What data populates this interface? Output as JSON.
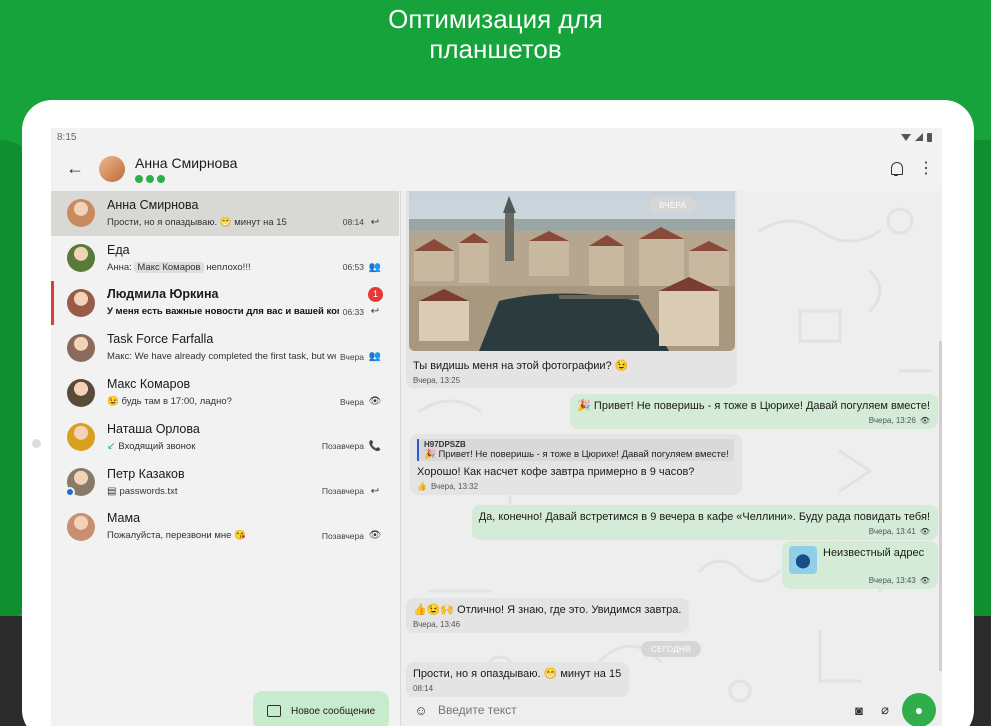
{
  "promo": {
    "line1": "Оптимизация для",
    "line2": "планшетов"
  },
  "statusbar": {
    "time": "8:15"
  },
  "toolbar": {
    "back_icon": "arrow-back-icon",
    "title": "Анна Смирнова",
    "bell_icon": "bell-icon",
    "more_icon": "more-vert-icon"
  },
  "chats": [
    {
      "name": "Анна Смирнова",
      "preview": "Прости, но я опаздываю. 😁 минут на 15",
      "time": "08:14",
      "status_icon": "reply-icon",
      "status_glyph": "↩",
      "selected": true,
      "avatar_color": "#c98a5e"
    },
    {
      "name": "Еда",
      "preview_prefix": "Анна:",
      "preview_chip": "Макс Комаров",
      "preview": "неплохо!!!",
      "time": "06:53",
      "status_icon": "group-icon",
      "status_glyph": "👥",
      "avatar_color": "#5a7a3a"
    },
    {
      "name": "Людмила Юркина",
      "preview": "У меня есть важные новости для вас и вашей ком",
      "time": "06:33",
      "status_icon": "reply-icon",
      "status_glyph": "↩",
      "unread": "1",
      "avatar_color": "#9a5a4a"
    },
    {
      "name": "Task Force Farfalla",
      "preview_prefix": "Макс:",
      "preview": "We have already completed the first task, but we",
      "time": "Вчера",
      "status_icon": "group-icon",
      "status_glyph": "👥",
      "avatar_color": "#8a6a5a"
    },
    {
      "name": "Макс Комаров",
      "preview": "😉 будь там в 17:00, ладно?",
      "time": "Вчера",
      "status_icon": "eye-icon",
      "status_glyph": "👁",
      "avatar_color": "#5a4a3a"
    },
    {
      "name": "Наташа Орлова",
      "preview_icon": "missed-call-icon",
      "preview_icon_glyph": "↙",
      "preview": "Входящий звонок",
      "time": "Позавчера",
      "status_icon": "phone-callback-icon",
      "status_glyph": "📞",
      "avatar_color": "#d9a020"
    },
    {
      "name": "Петр Казаков",
      "preview_icon": "file-icon",
      "preview_icon_glyph": "▤",
      "preview": "passwords.txt",
      "time": "Позавчера",
      "status_icon": "reply-icon",
      "status_glyph": "↩",
      "avatar_color": "#8a7a6a",
      "badge": true
    },
    {
      "name": "Мама",
      "preview": "Пожалуйста, перезвони мне 😘",
      "time": "Позавчера",
      "status_icon": "eye-icon",
      "status_glyph": "👁",
      "avatar_color": "#c89070"
    }
  ],
  "fab": {
    "label": "Новое сообщение",
    "icon": "chat-icon"
  },
  "messages": {
    "date_yesterday": "ВЧЕРА",
    "photo_caption": "Ты видишь меня на этой фотографии? 😉",
    "photo_time": "Вчера, 13:25",
    "m2_text": "🎉 Привет! Не поверишь - я тоже в Цюрихе! Давай погуляем вместе!",
    "m2_time": "Вчера, 13:26",
    "m3_quote_author": "H97DPSZB",
    "m3_quote_text": "🎉 Привет! Не поверишь - я тоже в Цюрихе! Давай погуляем вместе!",
    "m3_text": "Хорошо! Как насчет кофе завтра примерно в 9 часов?",
    "m3_time": "Вчера, 13:32",
    "m3_reaction": "👍",
    "m4_text": "Да, конечно! Давай встретимся в 9 вечера в кафе «Челлини». Буду рада повидать тебя!",
    "m4_time": "Вчера, 13:41",
    "m5_text": "Неизвестный адрес",
    "m5_time": "Вчера, 13:43",
    "m6_text": "👍😉🙌 Отлично! Я знаю, где это. Увидимся завтра.",
    "m6_time": "Вчера, 13:46",
    "date_today": "СЕГОДНЯ",
    "m7_text": "Прости, но я опаздываю. 😁 минут на 15",
    "m7_time": "08:14"
  },
  "composer": {
    "placeholder": "Введите текст",
    "emoji_icon": "emoji-icon",
    "camera_icon": "camera-icon",
    "attach_icon": "attach-icon",
    "mic_icon": "mic-icon"
  },
  "colors": {
    "brand_green": "#16a33b",
    "accent_green": "#2fae4b",
    "unread_red": "#e53935",
    "out_bubble": "#d4ecd7"
  }
}
